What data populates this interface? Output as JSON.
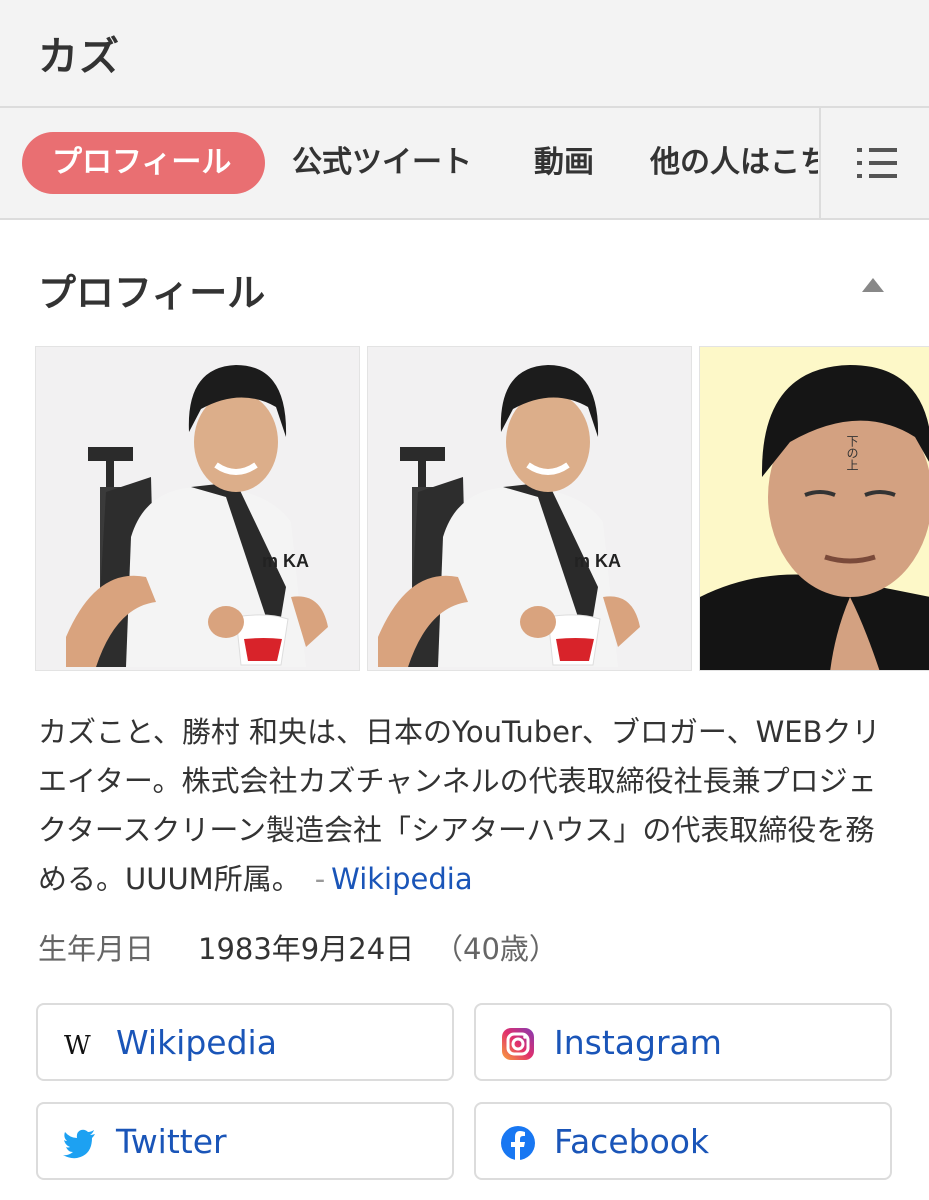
{
  "header": {
    "title": "カズ"
  },
  "tabs": [
    {
      "label": "プロフィール",
      "active": true
    },
    {
      "label": "公式ツイート"
    },
    {
      "label": "動画"
    },
    {
      "label": "他の人はこち"
    }
  ],
  "section": {
    "title": "プロフィール"
  },
  "description": {
    "text": "カズこと、勝村 和央は、日本のYouTuber、ブロガー、WEBクリエイター。株式会社カズチャンネルの代表取締役社長兼プロジェクタースクリーン製造会社「シアターハウス」の代表取締役を務める。UUUM所属。",
    "dash": "-",
    "source_label": "Wikipedia"
  },
  "birth": {
    "label": "生年月日",
    "value": "1983年9月24日",
    "age": "（40歳）"
  },
  "links": [
    {
      "label": "Wikipedia",
      "icon": "wikipedia-icon"
    },
    {
      "label": "Instagram",
      "icon": "instagram-icon"
    },
    {
      "label": "Twitter",
      "icon": "twitter-icon"
    },
    {
      "label": "Facebook",
      "icon": "facebook-icon"
    }
  ],
  "photos": [
    {
      "icon": "person-photo",
      "shirt_text": "m KA"
    },
    {
      "icon": "person-photo",
      "shirt_text": "m KA"
    },
    {
      "icon": "person-closeup-photo",
      "forehead_text": "下の上"
    }
  ],
  "colors": {
    "active_tab": "#e96f72",
    "link": "#1a55b8",
    "header_bg": "#f3f3f3",
    "twitter": "#1da1f2",
    "facebook": "#1877f2"
  }
}
